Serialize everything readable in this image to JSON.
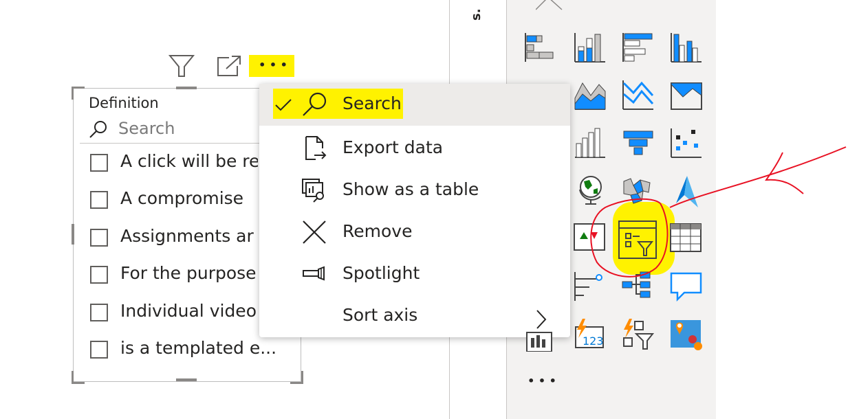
{
  "pane": {
    "title": "s."
  },
  "visual_header": {
    "filter_icon": "filter-icon",
    "focus_icon": "focus-mode-icon",
    "more_label": "• • •"
  },
  "slicer": {
    "title": "Definition",
    "search_placeholder": "Search",
    "items": [
      {
        "label": "A click will be re"
      },
      {
        "label": "A compromise"
      },
      {
        "label": "Assignments ar"
      },
      {
        "label": "For the purpose"
      },
      {
        "label": "Individual video"
      },
      {
        "label": "is a templated e..."
      }
    ]
  },
  "context_menu": {
    "items": [
      {
        "label": "Search",
        "icon": "magnifier-icon",
        "checked": true
      },
      {
        "label": "Export data",
        "icon": "export-data-icon"
      },
      {
        "label": "Show as a table",
        "icon": "show-as-table-icon"
      },
      {
        "label": "Remove",
        "icon": "close-icon"
      },
      {
        "label": "Spotlight",
        "icon": "spotlight-icon"
      },
      {
        "label": "Sort axis",
        "icon": "chevron-right-icon"
      }
    ]
  },
  "gallery": {
    "more_label": "• • •",
    "selected": "slicer-icon"
  },
  "colors": {
    "highlight": "#fff200",
    "accent": "#118dff",
    "annotation": "#e81123"
  }
}
